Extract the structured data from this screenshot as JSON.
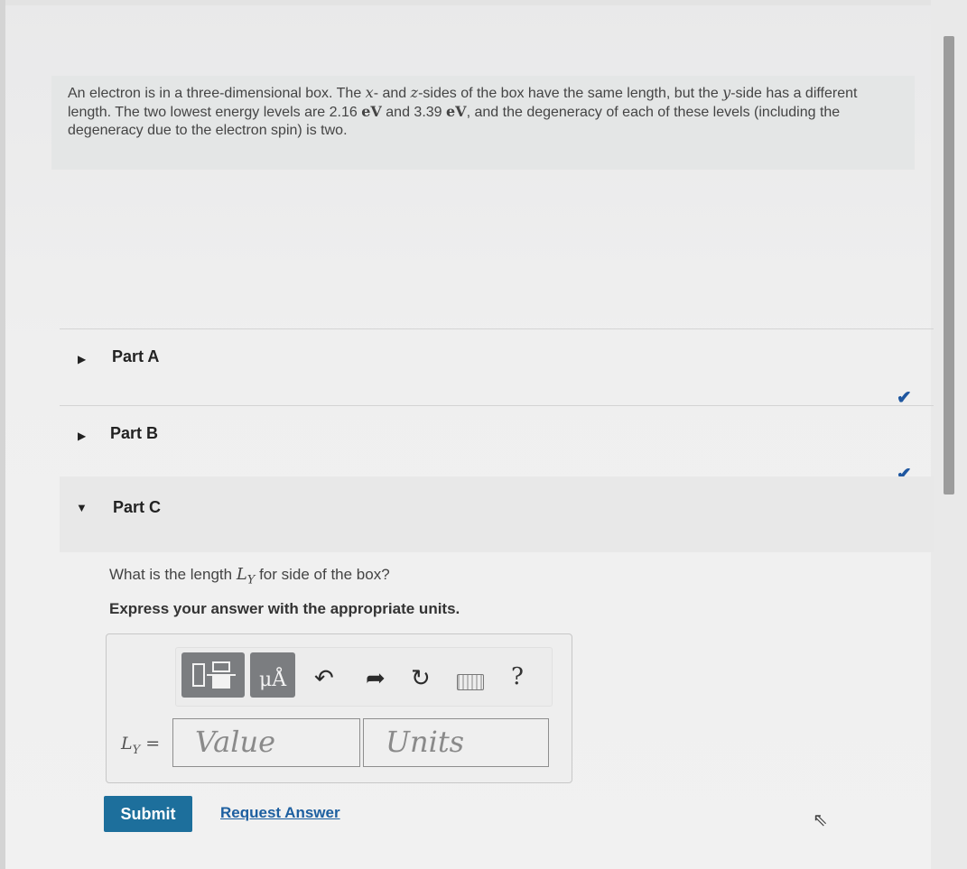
{
  "problem": {
    "line1_pre": "An electron is in a three-dimensional box. The ",
    "x_var": "x",
    "and_z": "- and ",
    "z_var": "z",
    "mid": "-sides of the box have the same length, but the ",
    "y_var": "y",
    "line1_post": "-side has a different length. The two lowest energy levels are 2.16 ",
    "unit1": "eV",
    "and_text": " and 3.39 ",
    "unit2": "eV",
    "line_end": ", and the degeneracy of each of these levels (including the degeneracy due to the electron spin) is two."
  },
  "parts": [
    {
      "label": "Part A",
      "state": "collapsed",
      "complete": true
    },
    {
      "label": "Part B",
      "state": "collapsed",
      "complete": true
    },
    {
      "label": "Part C",
      "state": "expanded",
      "complete": false
    }
  ],
  "icons": {
    "collapsed": "▶",
    "expanded": "▼",
    "check": "✔",
    "undo": "↶",
    "redo": "➦",
    "reset": "↻",
    "cursor": "⇖"
  },
  "question": {
    "pre": "What is the length ",
    "var": "L",
    "sub": "Y",
    "post": " for side of the box?",
    "instruction": "Express your answer with the appropriate units."
  },
  "toolbar": {
    "units_symbol": "μÅ",
    "help": "?"
  },
  "answer": {
    "label_var": "L",
    "label_sub": "Y",
    "label_eq": " =",
    "value_placeholder": "Value",
    "units_placeholder": "Units"
  },
  "actions": {
    "submit": "Submit",
    "request": "Request Answer"
  },
  "colors": {
    "accent": "#1d6f9c",
    "check": "#1f57a0"
  }
}
